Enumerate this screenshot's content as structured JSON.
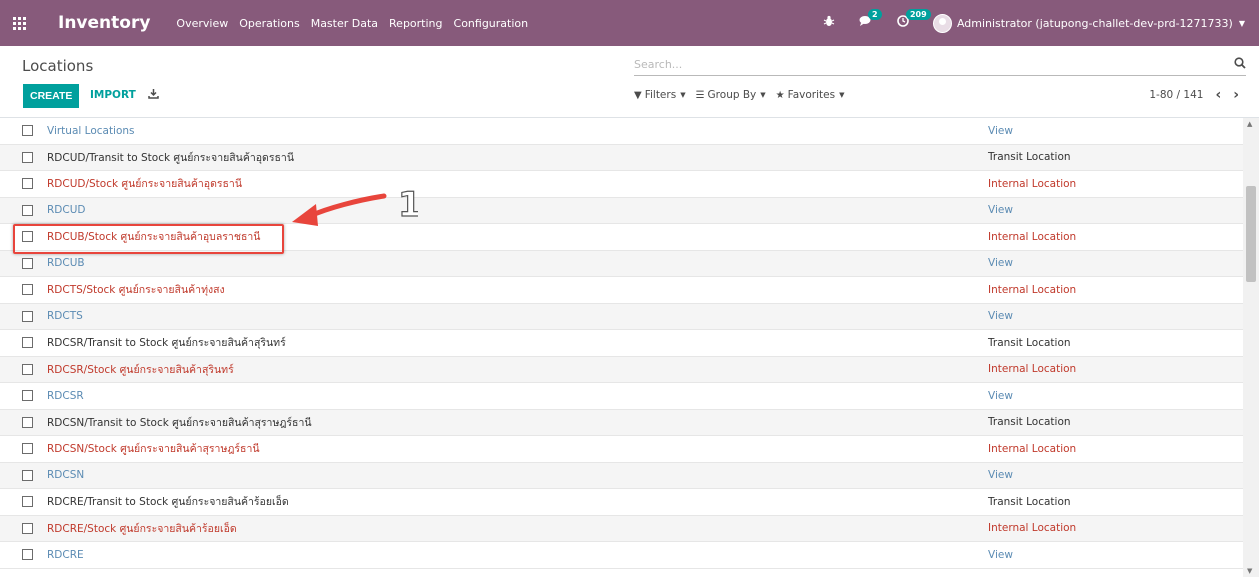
{
  "navbar": {
    "app_name": "Inventory",
    "menu": [
      "Overview",
      "Operations",
      "Master Data",
      "Reporting",
      "Configuration"
    ],
    "messages_badge": "2",
    "activities_badge": "209",
    "user_label": "Administrator (jatupong-challet-dev-prd-1271733)"
  },
  "control_panel": {
    "breadcrumb": "Locations",
    "search_placeholder": "Search...",
    "create_label": "CREATE",
    "import_label": "IMPORT",
    "filters_label": "Filters",
    "groupby_label": "Group By",
    "favorites_label": "Favorites",
    "pager": "1-80 / 141"
  },
  "colors": {
    "navbar": "#875a7b",
    "primary": "#00a09d",
    "view": "#5b8bb3",
    "internal": "#c0392b",
    "annotation": "#e8453c"
  },
  "rows": [
    {
      "name": "Virtual Locations",
      "type": "View",
      "kind": "view"
    },
    {
      "name": "RDCUD/Transit to Stock ศูนย์กระจายสินค้าอุดรธานี",
      "type": "Transit Location",
      "kind": "transit"
    },
    {
      "name": "RDCUD/Stock ศูนย์กระจายสินค้าอุดรธานี",
      "type": "Internal Location",
      "kind": "internal"
    },
    {
      "name": "RDCUD",
      "type": "View",
      "kind": "view"
    },
    {
      "name": "RDCUB/Stock ศูนย์กระจายสินค้าอุบลราชธานี",
      "type": "Internal Location",
      "kind": "internal"
    },
    {
      "name": "RDCUB",
      "type": "View",
      "kind": "view"
    },
    {
      "name": "RDCTS/Stock ศูนย์กระจายสินค้าทุ่งสง",
      "type": "Internal Location",
      "kind": "internal"
    },
    {
      "name": "RDCTS",
      "type": "View",
      "kind": "view"
    },
    {
      "name": "RDCSR/Transit to Stock ศูนย์กระจายสินค้าสุรินทร์",
      "type": "Transit Location",
      "kind": "transit"
    },
    {
      "name": "RDCSR/Stock ศูนย์กระจายสินค้าสุรินทร์",
      "type": "Internal Location",
      "kind": "internal"
    },
    {
      "name": "RDCSR",
      "type": "View",
      "kind": "view"
    },
    {
      "name": "RDCSN/Transit to Stock ศูนย์กระจายสินค้าสุราษฎร์ธานี",
      "type": "Transit Location",
      "kind": "transit"
    },
    {
      "name": "RDCSN/Stock ศูนย์กระจายสินค้าสุราษฎร์ธานี",
      "type": "Internal Location",
      "kind": "internal"
    },
    {
      "name": "RDCSN",
      "type": "View",
      "kind": "view"
    },
    {
      "name": "RDCRE/Transit to Stock ศูนย์กระจายสินค้าร้อยเอ็ด",
      "type": "Transit Location",
      "kind": "transit"
    },
    {
      "name": "RDCRE/Stock ศูนย์กระจายสินค้าร้อยเอ็ด",
      "type": "Internal Location",
      "kind": "internal"
    },
    {
      "name": "RDCRE",
      "type": "View",
      "kind": "view"
    }
  ],
  "annotation": {
    "step_number": "1"
  }
}
